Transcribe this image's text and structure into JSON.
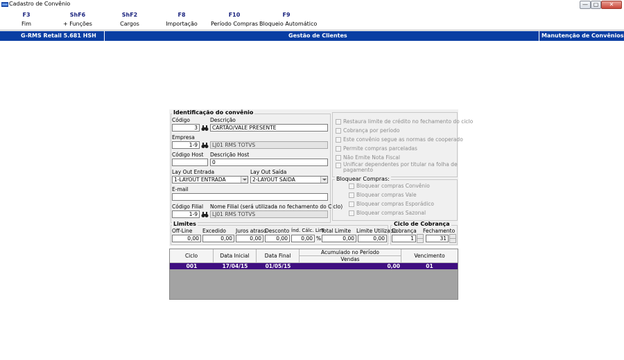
{
  "window": {
    "title": "Cadastro de Convênio",
    "minimize": "—",
    "maximize": "▢",
    "close": "✕"
  },
  "toolbar": [
    {
      "key": "F3",
      "label": "Fim"
    },
    {
      "key": "ShF6",
      "label": "+ Funções"
    },
    {
      "key": "ShF2",
      "label": "Cargos"
    },
    {
      "key": "F8",
      "label": "Importação"
    },
    {
      "key": "F10",
      "label": "Período Compras"
    },
    {
      "key": "F9",
      "label": "Bloqueio Automático"
    }
  ],
  "banner": {
    "version": "G-RMS Retail 5.681 HSH",
    "module": "Gestão de Clientes",
    "screen": "Manutenção de Convênios"
  },
  "identificacao": {
    "title": "Identificação do convênio",
    "codigo_label": "Código",
    "codigo_value": "3",
    "descricao_label": "Descrição",
    "descricao_value": "CARTÃO/VALE PRESENTE",
    "empresa_label": "Empresa",
    "empresa_code": "1-9",
    "empresa_name": "LJ01 RMS TOTVS",
    "codigo_host_label": "Código Host",
    "codigo_host_value": "",
    "descricao_host_label": "Descrição Host",
    "descricao_host_value": "0",
    "layout_entrada_label": "Lay Out Entrada",
    "layout_entrada_value": "1-LAYOUT ENTRADA",
    "layout_saida_label": "Lay Out Saída",
    "layout_saida_value": "2-LAYOUT SAIDA",
    "email_label": "E-mail",
    "email_value": "",
    "codigo_filial_label": "Código Filial",
    "codigo_filial_value": "1-9",
    "nome_filial_label": "Nome Filial (será utilizada no fechamento do Ciclo)",
    "nome_filial_value": "LJ01 RMS TOTVS"
  },
  "options": [
    "Restaura limite de crédito no fechamento do ciclo",
    "Cobrança por período",
    "Este convênio segue as normas de cooperado",
    "Permite compras parceladas",
    "Não Emite Nota Fiscal",
    "Unificar dependentes por titular na folha de",
    "pagamento"
  ],
  "bloquear": {
    "title": "Bloquear Compras:",
    "items": [
      "Bloquear compras Convênio",
      "Bloquear compras Vale",
      "Bloquear compras Esporádico",
      "Bloquear compras Sazonal"
    ]
  },
  "limites": {
    "title": "Limites",
    "fields": [
      {
        "label": "Off-Line",
        "value": "0,00"
      },
      {
        "label": "Excedido",
        "value": "0,00"
      },
      {
        "label": "Juros atraso",
        "value": "0,00"
      },
      {
        "label": "Desconto",
        "value": "0,00"
      },
      {
        "label": "Índ. Cálc. Lim",
        "value": "0,00",
        "unit": "%"
      },
      {
        "label": "Total Limite",
        "value": "0,00"
      },
      {
        "label": "Limite Utilizado",
        "value": "0,00"
      }
    ]
  },
  "ciclo_cobranca": {
    "title": "Ciclo de Cobrança",
    "cobranca_label": "Cobrança",
    "cobranca_value": "1",
    "fechamento_label": "Fechamento",
    "fechamento_value": "31"
  },
  "table": {
    "headers": {
      "ciclo": "Ciclo",
      "data_inicial": "Data Inicial",
      "data_final": "Data Final",
      "acumulado": "Acumulado no Período",
      "vendas": "Vendas",
      "vencimento": "Vencimento"
    },
    "rows": [
      {
        "ciclo": "001",
        "data_inicial": "17/04/15",
        "data_final": "01/05/15",
        "vendas": "0,00",
        "vencimento": "01"
      }
    ]
  }
}
